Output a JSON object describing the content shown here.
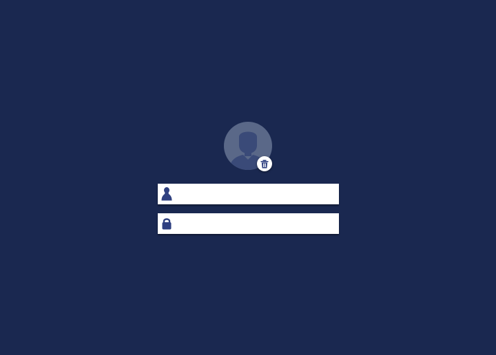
{
  "login": {
    "username": {
      "value": "",
      "placeholder": "",
      "icon": "user-icon"
    },
    "password": {
      "value": "",
      "placeholder": "",
      "icon": "lock-icon"
    },
    "avatar": {
      "icon": "user-silhouette-icon",
      "badge_icon": "trash-icon"
    }
  },
  "colors": {
    "background": "#1a2850",
    "avatar_bg": "#5a6888",
    "avatar_figure": "#3a4a78",
    "icon": "#2f4080",
    "field_bg": "#ffffff"
  }
}
